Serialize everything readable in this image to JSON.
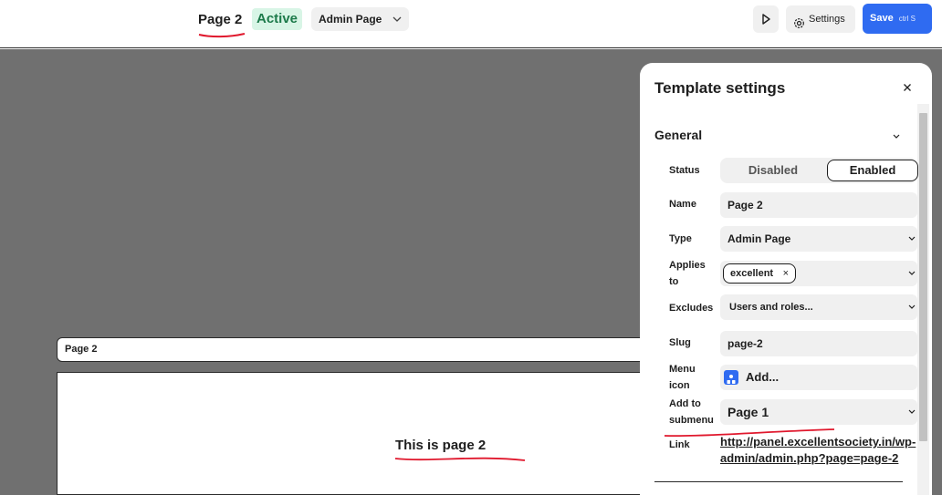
{
  "topbar": {
    "page_title": "Page 2",
    "status": "Active",
    "type_select": "Admin Page",
    "settings_label": "Settings",
    "save_label": "Save",
    "save_shortcut": "ctrl S"
  },
  "canvas": {
    "admin_bar_title": "Page 2",
    "content_text": "This is page 2"
  },
  "panel": {
    "title": "Template settings",
    "section": "General",
    "fields": {
      "status_label": "Status",
      "status_off": "Disabled",
      "status_on": "Enabled",
      "name_label": "Name",
      "name_value": "Page 2",
      "type_label": "Type",
      "type_value": "Admin Page",
      "applies_label": "Applies to",
      "applies_tag": "excellent",
      "excludes_label": "Excludes",
      "excludes_placeholder": "Users and roles...",
      "slug_label": "Slug",
      "slug_value": "page-2",
      "menu_icon_label": "Menu icon",
      "menu_icon_value": "Add...",
      "submenu_label": "Add to submenu",
      "submenu_value": "Page 1",
      "link_label": "Link",
      "link_value": "http://panel.excellentsociety.in/wp-admin/admin.php?page=page-2"
    }
  },
  "colors": {
    "accent": "#2f6bf1",
    "status_bg": "#d8f5e6",
    "status_text": "#1c7a4a",
    "canvas_bg": "#707070",
    "annotation_red": "#e0182d"
  }
}
